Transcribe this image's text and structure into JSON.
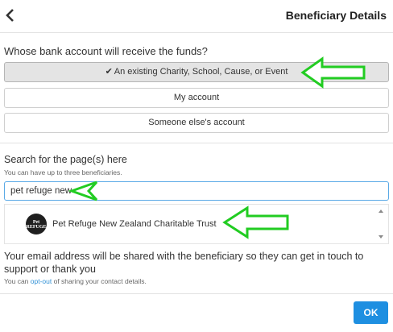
{
  "header": {
    "title": "Beneficiary Details",
    "back_icon": "chevron-left-icon"
  },
  "bank_account": {
    "question": "Whose bank account will receive the funds?",
    "options": [
      {
        "label": "An existing Charity, School, Cause, or Event",
        "selected": true
      },
      {
        "label": "My account",
        "selected": false
      },
      {
        "label": "Someone else's account",
        "selected": false
      }
    ],
    "check_glyph": "✔"
  },
  "search": {
    "label": "Search for the page(s) here",
    "hint": "You can have up to three beneficiaries.",
    "value": "pet refuge new",
    "results": [
      {
        "name": "Pet Refuge New Zealand Charitable Trust",
        "logo_text_top": "Pet",
        "logo_text_bottom": "REFUGE"
      }
    ]
  },
  "email_notice": {
    "text": "Your email address will be shared with the beneficiary so they can get in touch to support or thank you",
    "optout_prefix": "You can ",
    "optout_link": "opt-out",
    "optout_suffix": " of sharing your contact details."
  },
  "actions": {
    "ok_label": "OK"
  },
  "colors": {
    "accent": "#1e8fe1",
    "annotation_arrow": "#22cc22"
  }
}
